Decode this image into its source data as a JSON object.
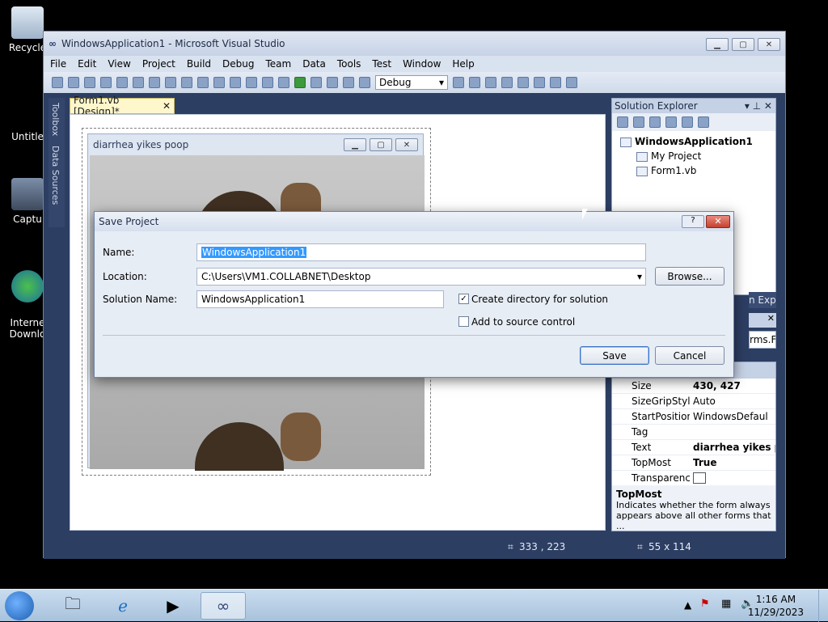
{
  "desktop": {
    "icons": [
      {
        "label": "Recycle"
      },
      {
        "label": "Untitle"
      },
      {
        "label": "Captu"
      },
      {
        "label": "Interne\nDownlo"
      }
    ]
  },
  "vs": {
    "title": "WindowsApplication1 - Microsoft Visual Studio",
    "menu": [
      "File",
      "Edit",
      "View",
      "Project",
      "Build",
      "Debug",
      "Team",
      "Data",
      "Tools",
      "Test",
      "Window",
      "Help"
    ],
    "config": "Debug",
    "left_tabs": [
      "Toolbox",
      "Data Sources"
    ],
    "doc_tab": "Form1.vb [Design]*",
    "form_title": "diarrhea yikes poop",
    "solution_explorer": {
      "title": "Solution Explorer",
      "root": "WindowsApplication1",
      "items": [
        "My Project",
        "Form1.vb"
      ],
      "tab_overflow": "n Explo..."
    },
    "props_header": "rms.Fo",
    "properties": [
      {
        "name": "Size",
        "value": "430, 427"
      },
      {
        "name": "SizeGripStyle",
        "value": "Auto"
      },
      {
        "name": "StartPosition",
        "value": "WindowsDefaul"
      },
      {
        "name": "Tag",
        "value": ""
      },
      {
        "name": "Text",
        "value": "diarrhea yikes p"
      },
      {
        "name": "TopMost",
        "value": "True"
      },
      {
        "name": "Transparency",
        "value": ""
      }
    ],
    "prop_desc_title": "TopMost",
    "prop_desc": "Indicates whether the form always appears above all other forms that ...",
    "status_pos": "333 , 223",
    "status_size": "55 x 114"
  },
  "dialog": {
    "title": "Save Project",
    "help_label": "?",
    "name_label": "Name:",
    "name_value": "WindowsApplication1",
    "location_label": "Location:",
    "location_value": "C:\\Users\\VM1.COLLABNET\\Desktop",
    "browse_label": "Browse...",
    "solution_label": "Solution Name:",
    "solution_value": "WindowsApplication1",
    "create_dir_label": "Create directory for solution",
    "create_dir_checked": true,
    "source_control_label": "Add to source control",
    "source_control_checked": false,
    "save_label": "Save",
    "cancel_label": "Cancel"
  },
  "taskbar": {
    "time": "1:16 AM",
    "date": "11/29/2023"
  }
}
